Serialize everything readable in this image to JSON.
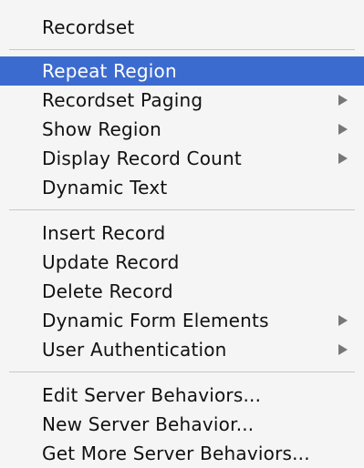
{
  "menu": {
    "item_recordset": "Recordset",
    "item_repeat_region": "Repeat Region",
    "item_recordset_paging": "Recordset Paging",
    "item_show_region": "Show Region",
    "item_display_record_count": "Display Record Count",
    "item_dynamic_text": "Dynamic Text",
    "item_insert_record": "Insert Record",
    "item_update_record": "Update Record",
    "item_delete_record": "Delete Record",
    "item_dynamic_form_elements": "Dynamic Form Elements",
    "item_user_authentication": "User Authentication",
    "item_edit_server_behaviors": "Edit Server Behaviors...",
    "item_new_server_behavior": "New Server Behavior...",
    "item_get_more_server_behaviors": "Get More Server Behaviors..."
  },
  "icons": {
    "submenu_arrow": "submenu-arrow-icon"
  },
  "colors": {
    "highlight": "#3c6bd0",
    "menu_background": "#f5f5f5",
    "text": "#111111",
    "highlight_text": "#ffffff",
    "arrow": "#777777"
  }
}
